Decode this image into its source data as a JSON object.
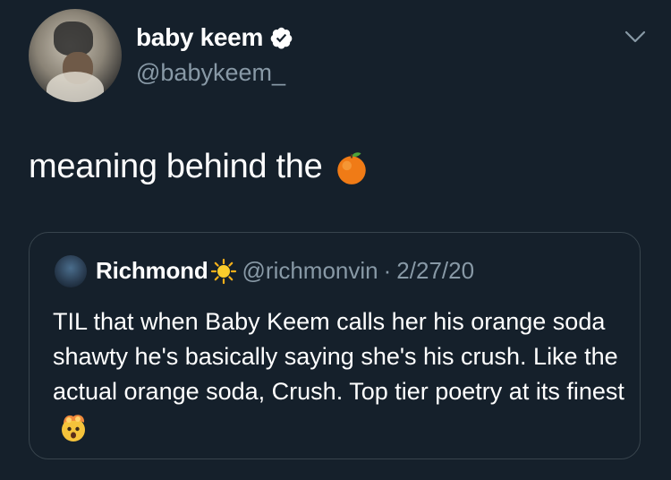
{
  "author": {
    "display_name": "baby keem",
    "handle": "@babykeem_",
    "verified": true,
    "avatar": "profile-photo"
  },
  "tweet": {
    "text": "meaning behind the",
    "emoji": "orange-emoji"
  },
  "quoted_tweet": {
    "display_name": "Richmond",
    "name_emoji": "sun-emoji",
    "handle": "@richmonvin",
    "separator": "·",
    "date": "2/27/20",
    "body": "TIL that when Baby Keem calls her his orange soda shawty he's basically saying she's his crush. Like the actual orange soda, Crush. Top tier poetry at its finest",
    "body_emoji": "exploding-head-emoji"
  },
  "colors": {
    "background": "#15202b",
    "text_primary": "#ffffff",
    "text_secondary": "#8899a6",
    "border": "#38444d"
  }
}
